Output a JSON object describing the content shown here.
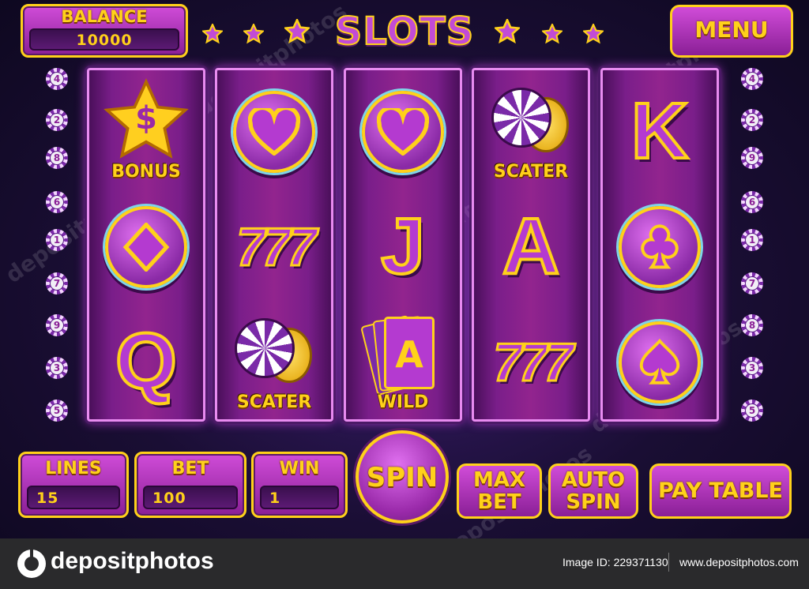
{
  "balance": {
    "label": "BALANCE",
    "value": "10000"
  },
  "title": "SLOTS",
  "menu": {
    "label": "MENU"
  },
  "line_markers": {
    "left": [
      "4",
      "2",
      "8",
      "6",
      "1",
      "7",
      "9",
      "3",
      "5"
    ],
    "right": [
      "4",
      "2",
      "9",
      "6",
      "1",
      "7",
      "8",
      "3",
      "5"
    ]
  },
  "reels": [
    [
      {
        "symbol": "bonus-star",
        "label": "BONUS",
        "glyph": "$"
      },
      {
        "symbol": "diamond-suit"
      },
      {
        "symbol": "letter-q",
        "glyph": "Q"
      }
    ],
    [
      {
        "symbol": "heart-suit"
      },
      {
        "symbol": "seven",
        "glyph": "777"
      },
      {
        "symbol": "scatter-chips",
        "label": "SCATER"
      }
    ],
    [
      {
        "symbol": "heart-suit"
      },
      {
        "symbol": "letter-j",
        "glyph": "J"
      },
      {
        "symbol": "wild-cards",
        "label": "WILD",
        "glyph": "A"
      }
    ],
    [
      {
        "symbol": "scatter-chips",
        "label": "SCATER"
      },
      {
        "symbol": "letter-a",
        "glyph": "A"
      },
      {
        "symbol": "seven",
        "glyph": "777"
      }
    ],
    [
      {
        "symbol": "letter-k",
        "glyph": "K"
      },
      {
        "symbol": "club-suit"
      },
      {
        "symbol": "spade-suit"
      }
    ]
  ],
  "controls": {
    "lines": {
      "label": "LINES",
      "value": "15"
    },
    "bet": {
      "label": "BET",
      "value": "100"
    },
    "win": {
      "label": "WIN",
      "value": "1"
    },
    "spin": "SPIN",
    "max_bet": [
      "MAX",
      "BET"
    ],
    "auto_spin": [
      "AUTO",
      "SPIN"
    ],
    "pay_table": "PAY TABLE"
  },
  "watermark": "depositphotos",
  "footer": {
    "brand": "depositphotos",
    "image_id": "Image ID: 229371130",
    "url": "www.depositphotos.com"
  },
  "colors": {
    "gold": "#ffd11a",
    "purple": "#b43ad0",
    "background": "#1a0e34"
  }
}
